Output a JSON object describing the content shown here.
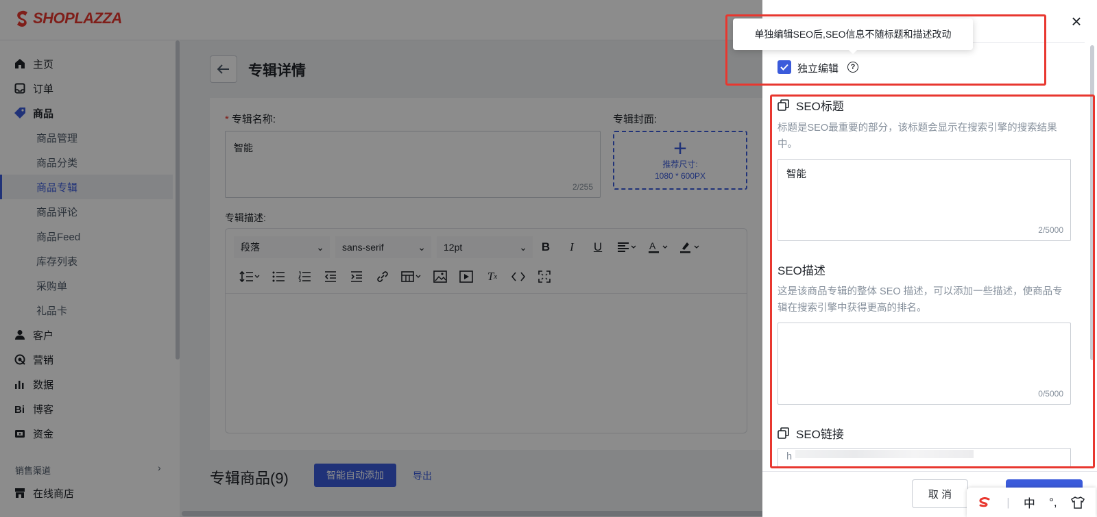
{
  "brand": {
    "name": "SHOPLAZZA",
    "color": "#e8372f"
  },
  "sidebar": {
    "items": [
      {
        "label": "主页",
        "icon": "home-icon"
      },
      {
        "label": "订单",
        "icon": "inbox-icon"
      },
      {
        "label": "商品",
        "icon": "tag-icon"
      },
      {
        "label": "商品管理"
      },
      {
        "label": "商品分类"
      },
      {
        "label": "商品专辑"
      },
      {
        "label": "商品评论"
      },
      {
        "label": "商品Feed"
      },
      {
        "label": "库存列表"
      },
      {
        "label": "采购单"
      },
      {
        "label": "礼品卡"
      },
      {
        "label": "客户",
        "icon": "user-icon"
      },
      {
        "label": "营销",
        "icon": "marketing-icon"
      },
      {
        "label": "数据",
        "icon": "bar-chart-icon"
      },
      {
        "label": "博客",
        "icon": "blog-icon"
      },
      {
        "label": "资金",
        "icon": "wallet-icon"
      }
    ],
    "section_label": "销售渠道",
    "online_store": "在线商店"
  },
  "page": {
    "title": "专辑详情",
    "name_label": "专辑名称:",
    "name_value": "智能",
    "name_counter": "2/255",
    "cover_label": "专辑封面:",
    "cover_hint_1": "推荐尺寸:",
    "cover_hint_2": "1080 * 600PX",
    "desc_label": "专辑描述:",
    "editor": {
      "paragraph": "段落",
      "font": "sans-serif",
      "size": "12pt"
    },
    "products_title": "专辑商品(9)",
    "auto_add": "智能自动添加",
    "export": "导出"
  },
  "drawer": {
    "tooltip": "单独编辑SEO后,SEO信息不随标题和描述改动",
    "independent_edit": "独立编辑",
    "independent_checked": true,
    "seo_title": {
      "heading": "SEO标题",
      "help": "标题是SEO最重要的部分，该标题会显示在搜索引擎的搜索结果中。",
      "value": "智能",
      "counter": "2/5000"
    },
    "seo_desc": {
      "heading": "SEO描述",
      "help": "这是该商品专辑的整体 SEO 描述，可以添加一些描述，使商品专辑在搜索引擎中获得更高的排名。",
      "value": "",
      "counter": "0/5000"
    },
    "seo_link": {
      "heading": "SEO链接",
      "value": "h"
    },
    "cancel": "取 消"
  },
  "ime": {
    "lang": "中",
    "punct": "°,"
  },
  "colors": {
    "accent": "#3b5bdb",
    "highlight": "#e8372f"
  }
}
